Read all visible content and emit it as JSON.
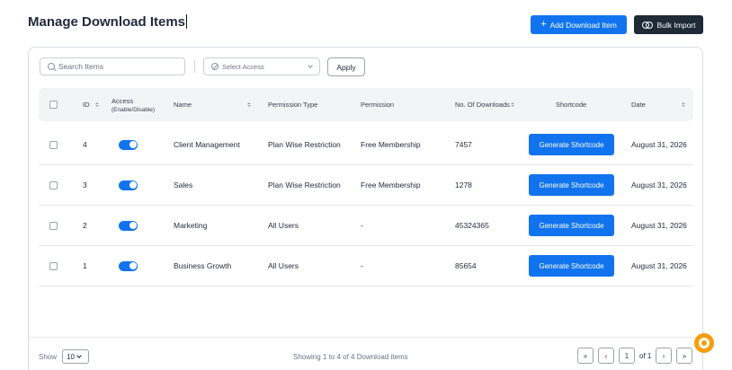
{
  "header": {
    "title": "Manage Download Items",
    "add_button": "Add Download Item",
    "add_icon": "+",
    "bulk_button": "Bulk Import"
  },
  "filters": {
    "search_placeholder": "Search Items",
    "access_placeholder": "Select Access",
    "apply_label": "Apply"
  },
  "table": {
    "columns": {
      "id": "ID",
      "access": "Access",
      "access_sub": "(Enable/Disable)",
      "name": "Name",
      "permission_type": "Permission Type",
      "permission": "Permission",
      "downloads": "No. Of Downloads",
      "shortcode": "Shortcode",
      "date": "Date"
    },
    "rows": [
      {
        "id": "4",
        "enabled": true,
        "name": "Client Management",
        "permission_type": "Plan Wise Restriction",
        "permission": "Free Membership",
        "downloads": "7457",
        "shortcode_label": "Generate Shortcode",
        "date": "August 31, 2026"
      },
      {
        "id": "3",
        "enabled": true,
        "name": "Sales",
        "permission_type": "Plan Wise Restriction",
        "permission": "Free Membership",
        "downloads": "1278",
        "shortcode_label": "Generate Shortcode",
        "date": "August 31, 2026"
      },
      {
        "id": "2",
        "enabled": true,
        "name": "Marketing",
        "permission_type": "All Users",
        "permission": "-",
        "downloads": "45324365",
        "shortcode_label": "Generate Shortcode",
        "date": "August 31, 2026"
      },
      {
        "id": "1",
        "enabled": true,
        "name": "Business Growth",
        "permission_type": "All Users",
        "permission": "-",
        "downloads": "85654",
        "shortcode_label": "Generate Shortcode",
        "date": "August 31, 2026"
      }
    ]
  },
  "footer": {
    "show_label": "Show",
    "page_size": "10",
    "showing_text": "Showing 1 to 4 of 4 Download items",
    "first": "«",
    "prev": "‹",
    "current_page": "1",
    "of_text": "of 1",
    "next": "›",
    "last": "»"
  },
  "colors": {
    "primary": "#1174ee",
    "dark": "#1f2a37",
    "help_fab": "#f59e0b"
  },
  "icons": [
    "plus-icon",
    "bulk-import-icon",
    "search-icon",
    "ban-icon",
    "chevron-down-icon",
    "sort-icon",
    "help-icon"
  ]
}
